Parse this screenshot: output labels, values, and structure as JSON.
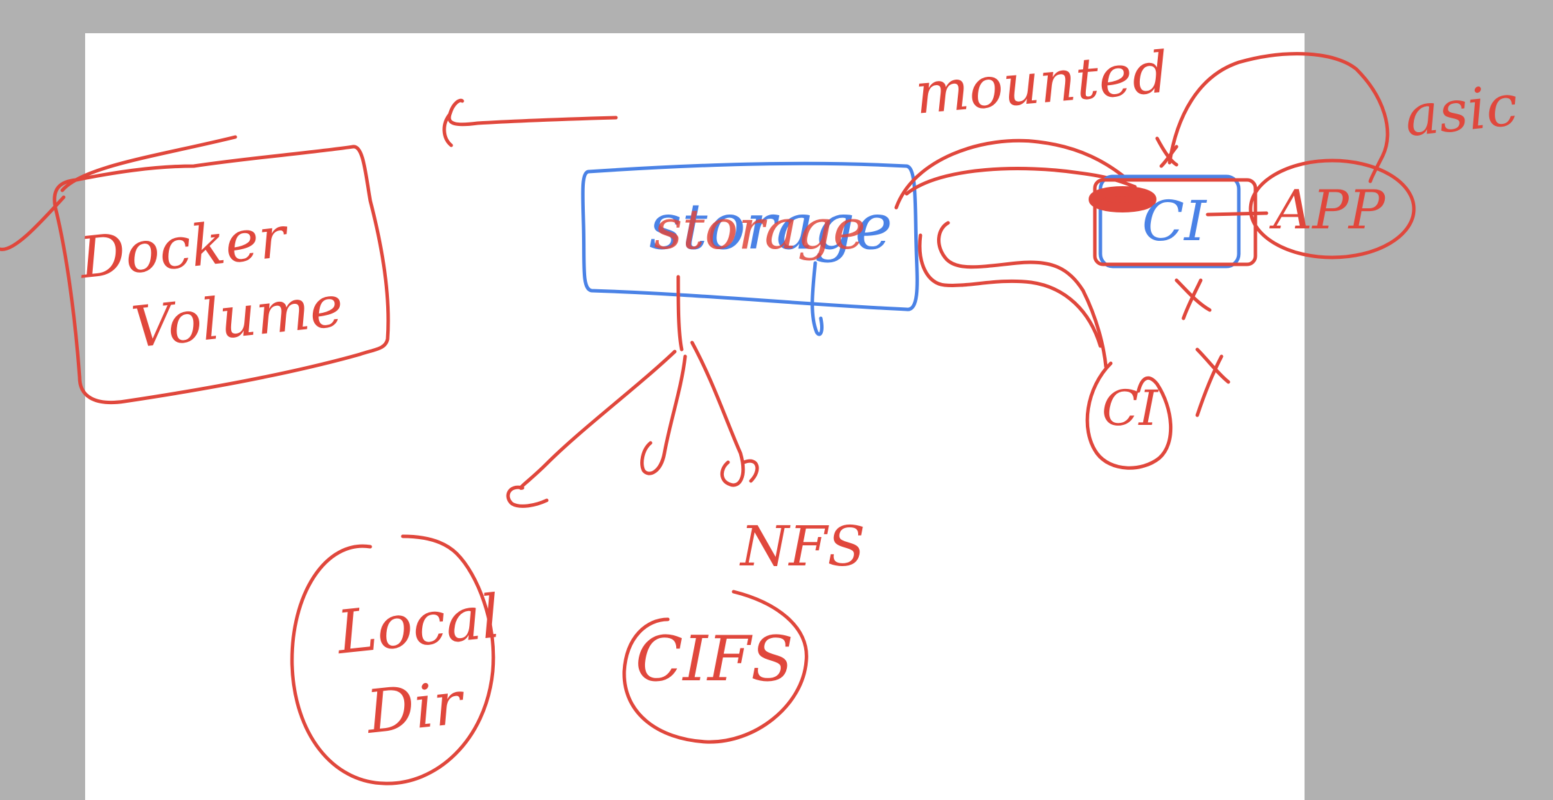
{
  "colors": {
    "background": "#b1b1b1",
    "page": "#ffffff",
    "red_ink": "#e0473c",
    "blue_ink": "#4a82e6"
  },
  "labels": {
    "docker_volume_line1": "Docker",
    "docker_volume_line2": "Volume",
    "storage": "storage",
    "mounted": "mounted",
    "ci_top": "CI",
    "app": "APP",
    "asic": "asic",
    "ci_bottom": "CI",
    "x_mark": "X",
    "local_dir_line1": "Local",
    "local_dir_line2": "Dir",
    "cifs": "CIFS",
    "nfs": "NFS"
  }
}
